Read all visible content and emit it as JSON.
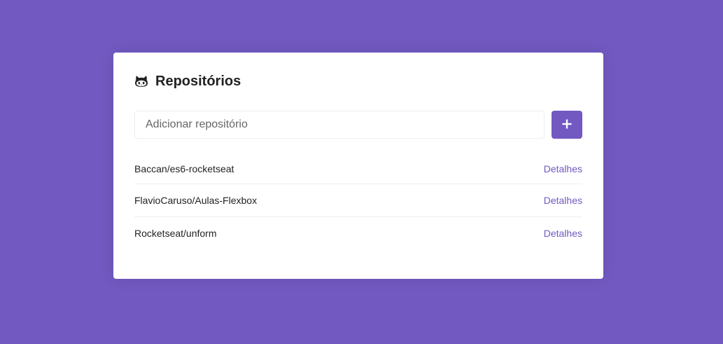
{
  "colors": {
    "background": "#7159c1",
    "card": "#ffffff",
    "accent": "#7159c1",
    "text": "#222222",
    "divider": "#eeeeee"
  },
  "header": {
    "icon": "github-icon",
    "title": "Repositórios"
  },
  "form": {
    "placeholder": "Adicionar repositório",
    "value": "",
    "submit_icon": "plus-icon"
  },
  "repositories": [
    {
      "name": "Baccan/es6-rocketseat",
      "link_label": "Detalhes"
    },
    {
      "name": "FlavioCaruso/Aulas-Flexbox",
      "link_label": "Detalhes"
    },
    {
      "name": "Rocketseat/unform",
      "link_label": "Detalhes"
    }
  ]
}
